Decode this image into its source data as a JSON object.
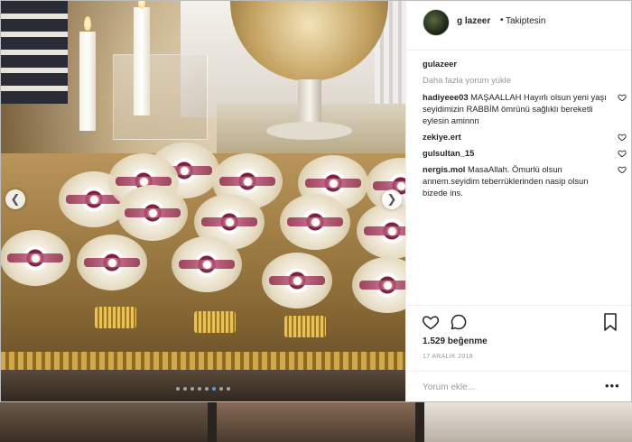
{
  "header": {
    "username": "g  lazeer",
    "separator": "•",
    "follow_status": "Takiptesin"
  },
  "comments": {
    "caption": {
      "user": "gulazeer",
      "text": ""
    },
    "load_more": "Daha fazla yorum yükle",
    "items": [
      {
        "user": "hadiyeee03",
        "text": "MAŞAALLAH Hayırlı olsun yeni yaşı seyidimizin RABBİM ömrünü sağlıklı bereketli eylesin aminnn"
      },
      {
        "user": "zekiye.ert",
        "text": ""
      },
      {
        "user": "gulsultan_15",
        "text": ""
      },
      {
        "user": "nergis.mol",
        "text": "MasaAllah. Ömurlü olsun annem.seyidim teberrüklerinden nasip olsun bizede ins."
      }
    ]
  },
  "actions": {
    "likes": "1.529 beğenme",
    "date": "17 ARALIK 2018",
    "comment_placeholder": "Yorum ekle...",
    "more_options": "•••"
  },
  "carousel": {
    "slide_count": 8,
    "active_slide": 6,
    "prev_icon": "chevron-left-icon",
    "next_icon": "chevron-right-icon"
  },
  "colors": {
    "active_dot": "#4e9bf0",
    "ribbon": "#8e2a4c"
  }
}
